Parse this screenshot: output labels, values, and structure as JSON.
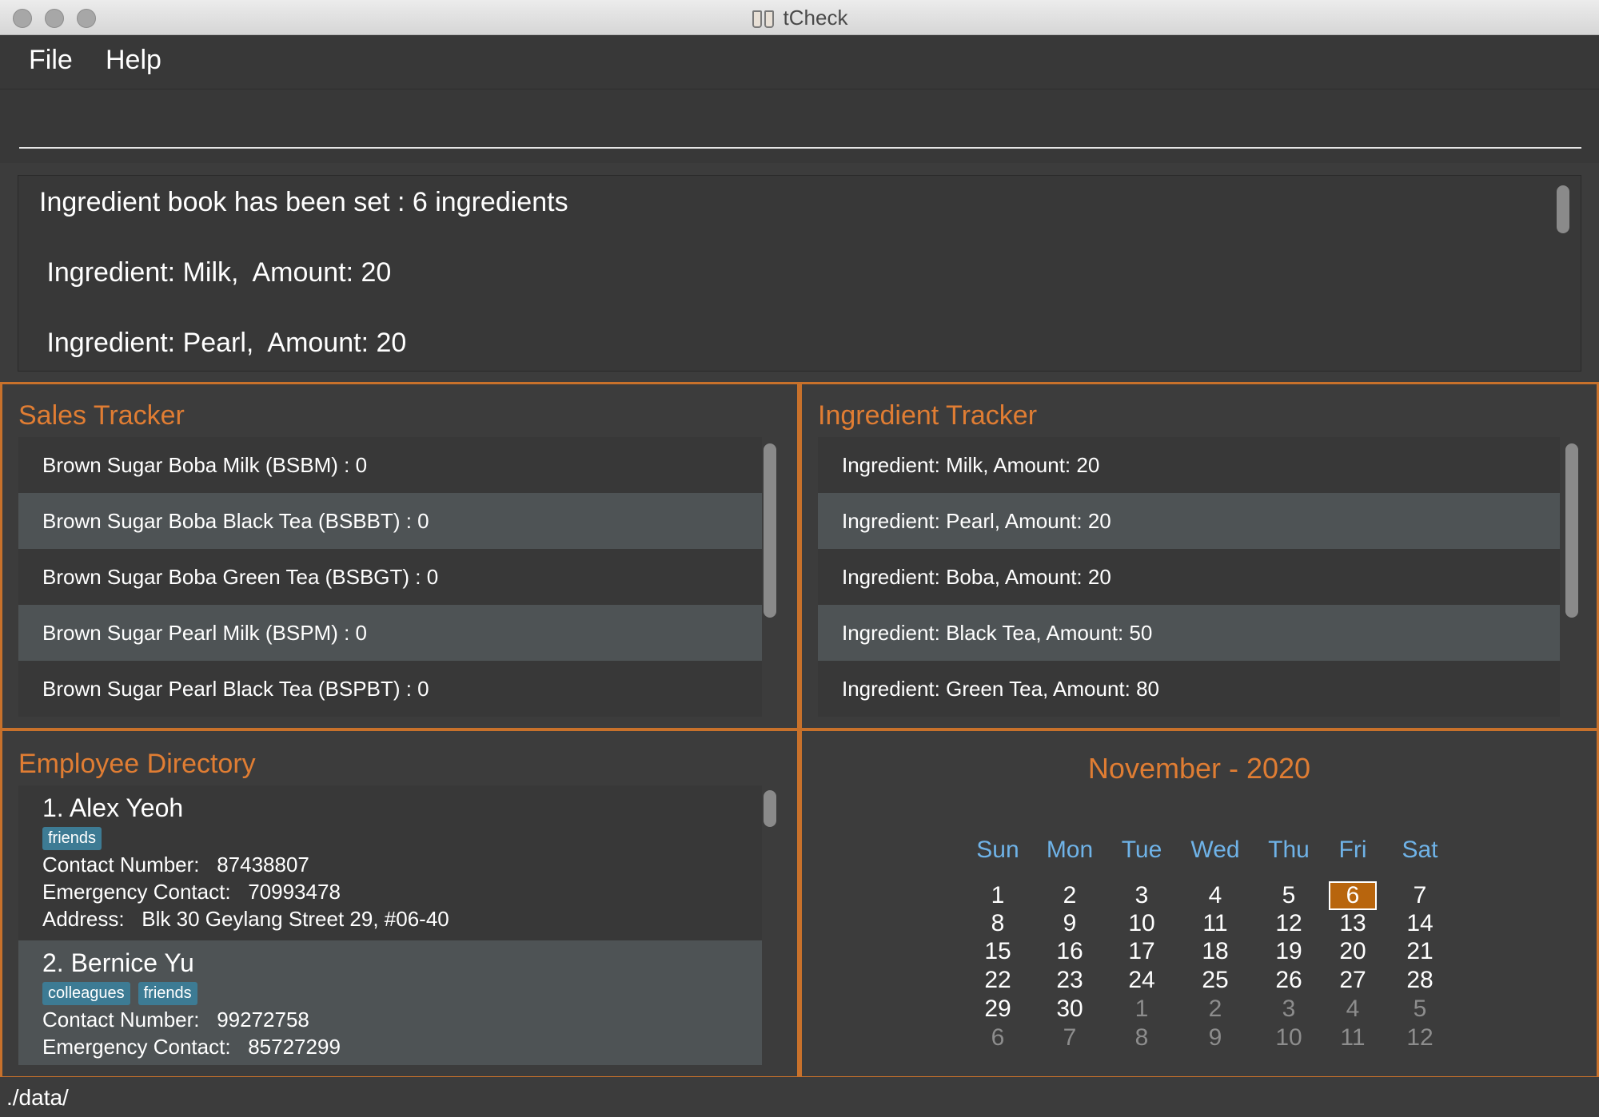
{
  "window": {
    "title": "tCheck"
  },
  "menu": [
    "File",
    "Help"
  ],
  "command": {
    "value": "",
    "placeholder": ""
  },
  "result": {
    "lines": [
      "Ingredient book has been set : 6 ingredients",
      " Ingredient: Milk,  Amount: 20",
      " Ingredient: Pearl,  Amount: 20"
    ]
  },
  "sales": {
    "title": "Sales Tracker",
    "items": [
      "Brown Sugar Boba Milk (BSBM) : 0",
      "Brown Sugar Boba Black Tea (BSBBT) : 0",
      "Brown Sugar Boba Green Tea (BSBGT) : 0",
      "Brown Sugar Pearl Milk (BSPM) : 0",
      "Brown Sugar Pearl Black Tea (BSPBT) : 0"
    ]
  },
  "ingredients": {
    "title": "Ingredient Tracker",
    "items": [
      "Ingredient: Milk,  Amount: 20",
      "Ingredient: Pearl,  Amount: 20",
      "Ingredient: Boba,  Amount: 20",
      "Ingredient: Black Tea,  Amount: 50",
      "Ingredient: Green Tea,  Amount: 80"
    ]
  },
  "employees": {
    "title": "Employee Directory",
    "items": [
      {
        "name": "1.   Alex Yeoh",
        "tags": [
          "friends"
        ],
        "contact": "Contact Number:   87438807",
        "emergency": "Emergency Contact:   70993478",
        "address": "Address:   Blk 30 Geylang Street 29, #06-40"
      },
      {
        "name": "2.   Bernice Yu",
        "tags": [
          "colleagues",
          "friends"
        ],
        "contact": "Contact Number:   99272758",
        "emergency": "Emergency Contact:   85727299"
      }
    ]
  },
  "calendar": {
    "title": "November - 2020",
    "weekdays": [
      "Sun",
      "Mon",
      "Tue",
      "Wed",
      "Thu",
      "Fri",
      "Sat"
    ],
    "weeks": [
      [
        "1",
        "2",
        "3",
        "4",
        "5",
        "6",
        "7"
      ],
      [
        "8",
        "9",
        "10",
        "11",
        "12",
        "13",
        "14"
      ],
      [
        "15",
        "16",
        "17",
        "18",
        "19",
        "20",
        "21"
      ],
      [
        "22",
        "23",
        "24",
        "25",
        "26",
        "27",
        "28"
      ],
      [
        "29",
        "30",
        "1",
        "2",
        "3",
        "4",
        "5"
      ],
      [
        "6",
        "7",
        "8",
        "9",
        "10",
        "11",
        "12"
      ]
    ],
    "today": "6",
    "colors": {
      "accent": "#e07d33",
      "weekday": "#6fb3e8",
      "today_bg": "#b8650d"
    }
  },
  "status": {
    "path": "./data/"
  }
}
